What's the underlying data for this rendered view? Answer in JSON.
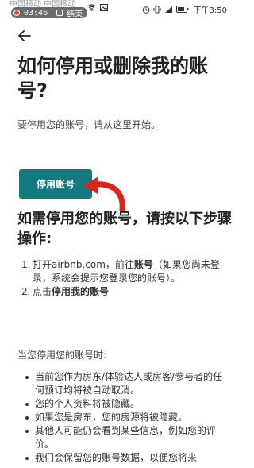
{
  "status_bar": {
    "carrier": "中国移动 中国移动 ",
    "recording_time": "03:46",
    "recording_end": "结束",
    "clock": "下午3:50"
  },
  "article": {
    "title": "如何停用或删除我的账号?",
    "intro": "要停用您的账号，请从这里开始。",
    "deactivate_button": "停用账号",
    "subtitle": "如需停用您的账号，请按以下步骤操作:",
    "steps": [
      {
        "num": "1.",
        "pre": "打开airbnb.com，前往",
        "link": "账号",
        "post": "（如果您尚未登录，系统会提示您登录您的账号）。"
      },
      {
        "num": "2.",
        "pre": "点击",
        "bold": "停用我的账号",
        "post": ""
      }
    ],
    "when_title": "当您停用您的账号时:",
    "bullets": [
      "当前您作为房东/体验达人或房客/参与者的任何预订均将被自动取消。",
      "您的个人资料将被隐藏。",
      "如果您是房东，您的房源将被隐藏。",
      "其他人可能仍会看到某些信息，例如您的评价。",
      "我们会保留您的账号数据，以便您将来"
    ]
  },
  "colors": {
    "button": "#137a80",
    "arrow": "#d9261c"
  }
}
